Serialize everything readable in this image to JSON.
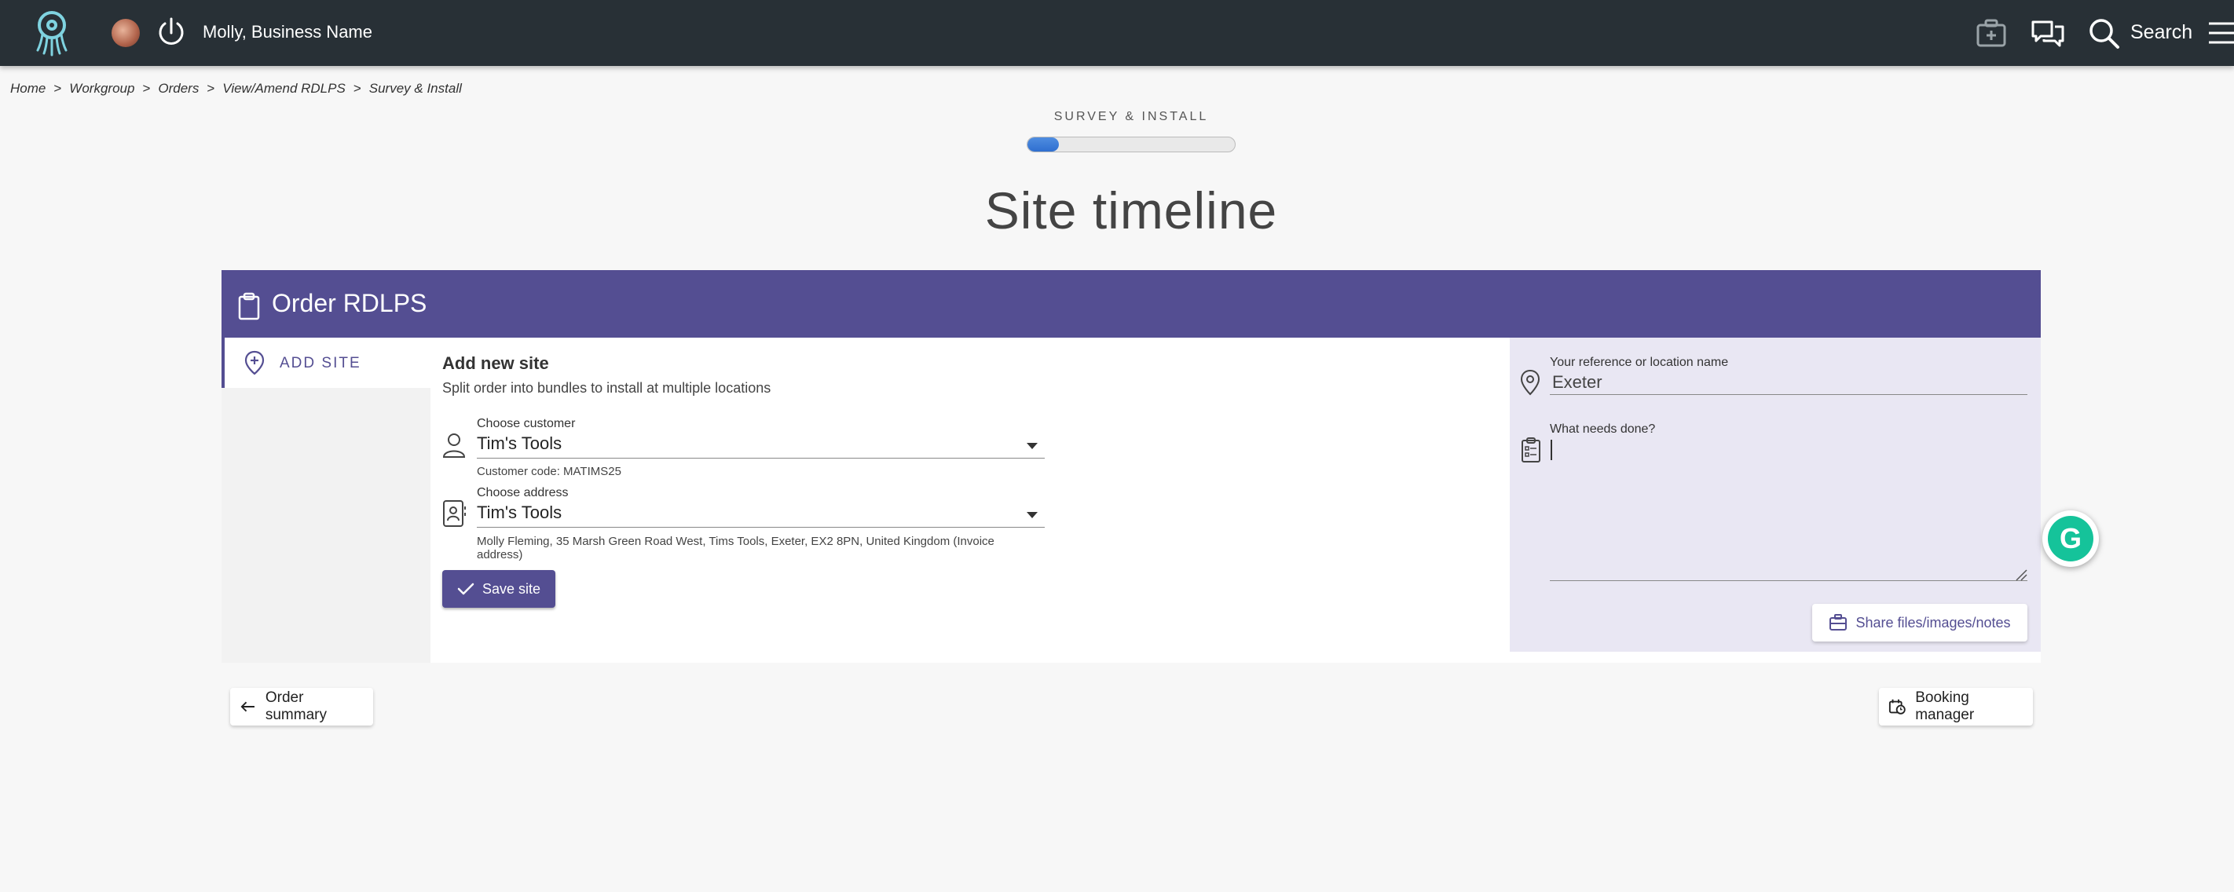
{
  "topbar": {
    "user_name": "Molly, Business Name",
    "search_label": "Search"
  },
  "breadcrumb": {
    "items": [
      "Home",
      "Workgroup",
      "Orders",
      "View/Amend RDLPS",
      "Survey & Install"
    ],
    "separator": ">"
  },
  "progress": {
    "stage_label": "SURVEY & INSTALL",
    "percent": 15
  },
  "page": {
    "title": "Site timeline"
  },
  "panel": {
    "header_title": "Order RDLPS",
    "side_tab_label": "ADD SITE",
    "form_title": "Add new site",
    "form_subtitle": "Split order into bundles to install at multiple locations",
    "customer": {
      "label": "Choose customer",
      "value": "Tim's Tools",
      "code_text": "Customer code: MATIMS25"
    },
    "address": {
      "label": "Choose address",
      "value": "Tim's Tools",
      "detail_line1": "Molly Fleming, 35 Marsh Green Road West, Tims Tools, Exeter, EX2 8PN, United Kingdom (Invoice",
      "detail_line2": "address)"
    },
    "save_label": "Save site",
    "reference": {
      "label": "Your reference or location name",
      "value": "Exeter"
    },
    "needs": {
      "label": "What needs done?"
    },
    "share_label": "Share files/images/notes"
  },
  "footer": {
    "order_summary_label": "Order summary",
    "booking_manager_label": "Booking manager"
  },
  "colors": {
    "topbar": "#283036",
    "accent": "#544e92",
    "panel_right": "#e9e7f3",
    "grammarly": "#15c39a"
  }
}
